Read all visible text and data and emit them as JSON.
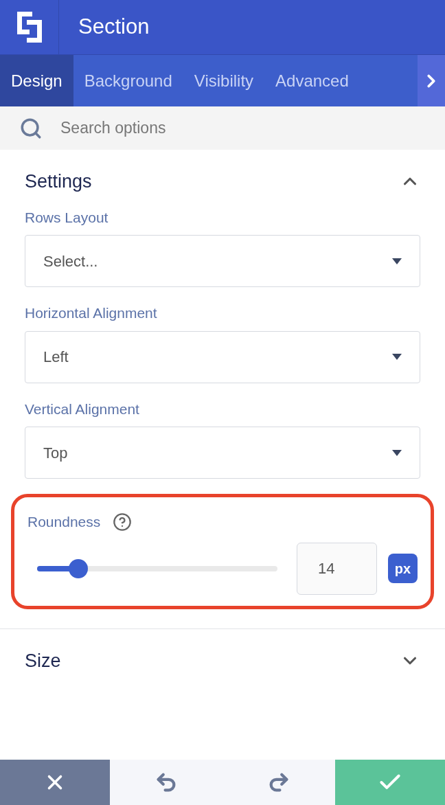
{
  "header": {
    "title": "Section"
  },
  "tabs": [
    {
      "label": "Design",
      "selected": true
    },
    {
      "label": "Background",
      "selected": false
    },
    {
      "label": "Visibility",
      "selected": false
    },
    {
      "label": "Advanced",
      "selected": false
    }
  ],
  "search": {
    "placeholder": "Search options"
  },
  "sections": [
    {
      "title": "Settings",
      "expanded": true,
      "fields": [
        {
          "kind": "select",
          "label": "Rows Layout",
          "value": "Select..."
        },
        {
          "kind": "select",
          "label": "Horizontal Alignment",
          "value": "Left"
        },
        {
          "kind": "select",
          "label": "Vertical Alignment",
          "value": "Top"
        },
        {
          "kind": "slider",
          "label": "Roundness",
          "highlighted": true,
          "level": 0.17,
          "value": "14",
          "unit": "px"
        }
      ]
    },
    {
      "title": "Size",
      "expanded": false
    }
  ]
}
